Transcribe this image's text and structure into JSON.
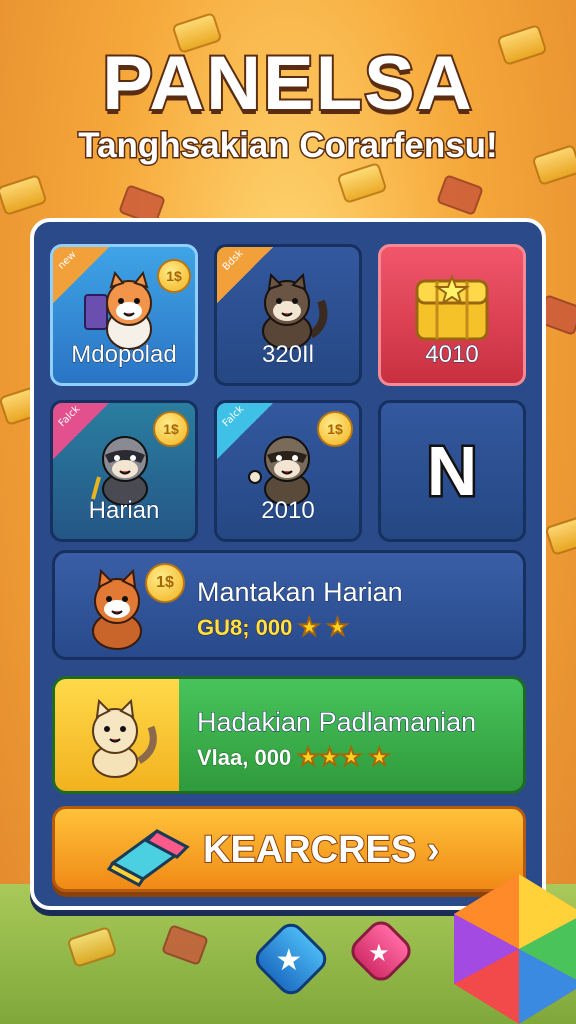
{
  "header": {
    "title": "PANELSA",
    "subtitle": "Tanghsakian Corarfensu!"
  },
  "grid": {
    "tiles": [
      {
        "label": "Mdopolad",
        "ribbon": "new",
        "icon": "hamster-icon"
      },
      {
        "label": "320Il",
        "ribbon": "Bdsk",
        "icon": "raccoon-icon"
      },
      {
        "label": "4010",
        "ribbon": "",
        "icon": "treasure-chest-icon"
      },
      {
        "label": "Harian",
        "ribbon": "Falck",
        "icon": "raccoon-icon"
      },
      {
        "label": "2010",
        "ribbon": "Falck",
        "icon": "raccoon-icon"
      },
      {
        "label": "",
        "ribbon": "",
        "icon": "N",
        "glyph": "N"
      }
    ]
  },
  "daily_bar": {
    "title": "Mantakan Harian",
    "value": "GU8; 000",
    "stars": "★ ★"
  },
  "reward_bar": {
    "title": "Hadakian Padlamanian",
    "value": "Vlaa, 000",
    "stars": "★★★ ★"
  },
  "cta": {
    "label": "KEARCRES",
    "arrow": "›"
  },
  "coin_text": "1$",
  "colors": {
    "panel": "#2a4a8a",
    "cta": "#f4a020",
    "reward": "#3cb04c",
    "highlight_tile": "#e03c50"
  }
}
